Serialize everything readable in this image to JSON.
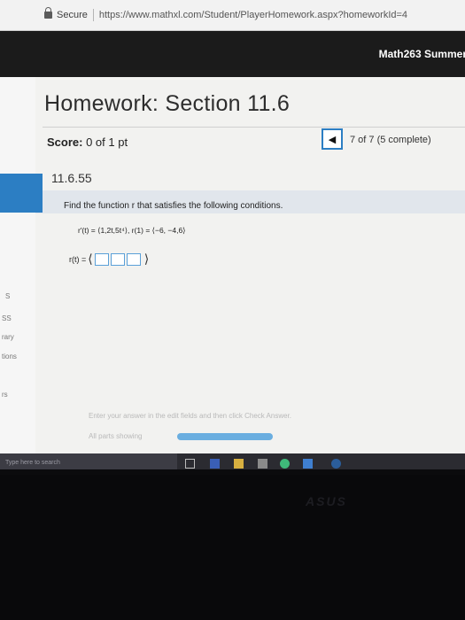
{
  "browser": {
    "secure_label": "Secure",
    "url": "https://www.mathxl.com/Student/PlayerHomework.aspx?homeworkId=4"
  },
  "header": {
    "course": "Math263 Summer"
  },
  "sidebar": {
    "labels": [
      "S",
      "SS",
      "rary",
      "tions",
      "rs"
    ]
  },
  "homework": {
    "title": "Homework: Section 11.6",
    "score_label": "Score:",
    "score_value": "0 of 1 pt",
    "progress": "7 of 7 (5 complete)",
    "question_number": "11.6.55"
  },
  "question": {
    "prompt": "Find the function r that satisfies the following conditions.",
    "conditions": "r′(t) = ⟨1,2t,5t⁴⟩, r(1) = ⟨−6, −4,6⟩",
    "answer_label": "r(t) ="
  },
  "footer": {
    "hint": "Enter your answer in the edit fields and then click Check Answer.",
    "parts_label": "All parts showing"
  },
  "taskbar": {
    "search_placeholder": "Type here to search"
  },
  "monitor": {
    "brand": "ASUS"
  }
}
